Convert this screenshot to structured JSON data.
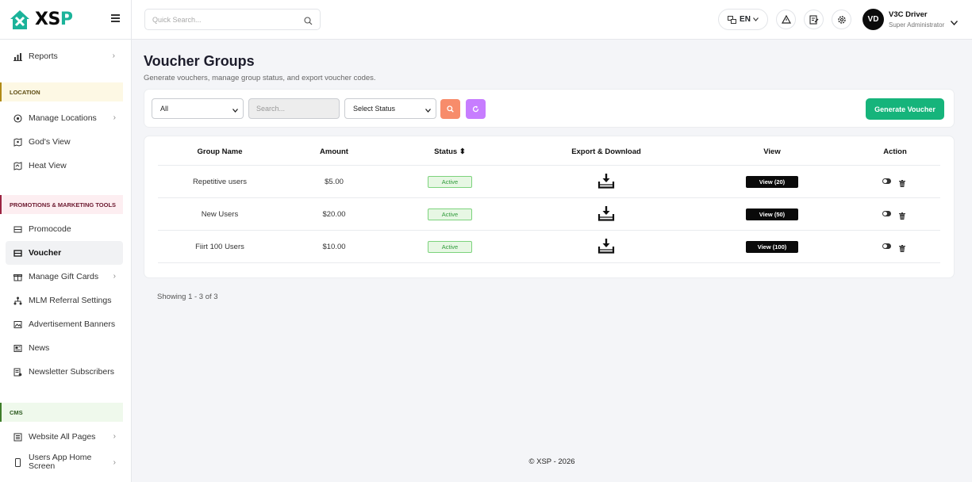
{
  "brand": {
    "logo_text_main": "XS",
    "logo_text_accent": "P"
  },
  "sidebar": {
    "items_top": [
      {
        "label": "Reports",
        "icon": "bar-chart-icon"
      }
    ],
    "sections": [
      {
        "title": "LOCATION",
        "items": [
          {
            "label": "Manage Locations",
            "icon": "location-pin-icon",
            "has_chevron": true
          },
          {
            "label": "God's View",
            "icon": "map-view-icon"
          },
          {
            "label": "Heat View",
            "icon": "heat-map-icon"
          }
        ]
      },
      {
        "title": "PROMOTIONS & MARKETING TOOLS",
        "items": [
          {
            "label": "Promocode",
            "icon": "ticket-icon"
          },
          {
            "label": "Voucher",
            "icon": "voucher-icon",
            "active": true
          },
          {
            "label": "Manage Gift Cards",
            "icon": "gift-icon",
            "has_chevron": true
          },
          {
            "label": "MLM Referral Settings",
            "icon": "network-icon"
          },
          {
            "label": "Advertisement Banners",
            "icon": "image-icon"
          },
          {
            "label": "News",
            "icon": "newspaper-icon"
          },
          {
            "label": "Newsletter Subscribers",
            "icon": "subscribers-icon"
          }
        ]
      },
      {
        "title": "CMS",
        "items": [
          {
            "label": "Website All Pages",
            "icon": "pages-icon",
            "has_chevron": true
          },
          {
            "label": "Users App Home Screen",
            "icon": "mobile-icon",
            "has_chevron": true
          }
        ]
      }
    ]
  },
  "header": {
    "search_placeholder": "Quick Search...",
    "language": "EN",
    "user_initials": "VD",
    "user_name": "V3C Driver",
    "user_role": "Super Administrator"
  },
  "page": {
    "title": "Voucher Groups",
    "subtitle": "Generate vouchers, manage group status, and export voucher codes."
  },
  "filters": {
    "type_selected": "All",
    "search_placeholder": "Search...",
    "status_selected": "Select Status",
    "generate_label": "Generate Voucher",
    "search_button_color": "#f78c6b",
    "reset_button_color": "#c77dff"
  },
  "table": {
    "headers": {
      "group_name": "Group Name",
      "amount": "Amount",
      "status": "Status",
      "status_sort_glyph": "⬍",
      "export": "Export & Download",
      "view": "View",
      "action": "Action"
    },
    "rows": [
      {
        "group_name": "Repetitive users",
        "amount": "$5.00",
        "status": "Active",
        "view_label": "View (20)"
      },
      {
        "group_name": "New Users",
        "amount": "$20.00",
        "status": "Active",
        "view_label": "View (50)"
      },
      {
        "group_name": "Fiirt 100 Users",
        "amount": "$10.00",
        "status": "Active",
        "view_label": "View (100)"
      }
    ]
  },
  "pagination": {
    "showing": "Showing 1 - 3 of 3"
  },
  "footer": {
    "text": "© XSP - 2026"
  },
  "colors": {
    "brand_green": "#1bb39a",
    "generate_green": "#16b47b",
    "active_badge": "#2f9a3a"
  }
}
